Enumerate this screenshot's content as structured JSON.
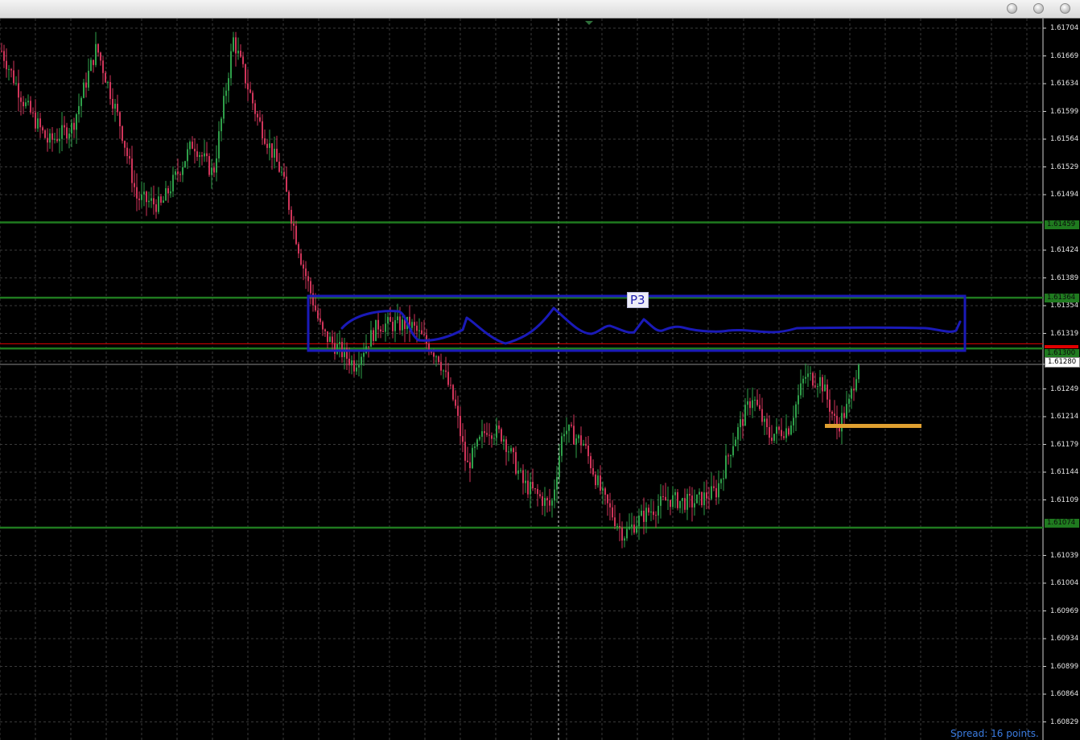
{
  "window": {
    "buttons": [
      "minimize",
      "zoom",
      "close"
    ]
  },
  "chart": {
    "instrument_type": "candlestick",
    "colors": {
      "background": "#000000",
      "grid": "#3a3a3a",
      "bull": "#2fa04a",
      "bear": "#d0355a",
      "level_line": "#1f7a1f",
      "rectangle": "#1a1ab8",
      "ask_line": "#e00000",
      "marker": "#e0a030"
    },
    "y_axis_labels": [
      "1.61704",
      "1.61669",
      "1.61634",
      "1.61599",
      "1.61564",
      "1.61529",
      "1.61494",
      "1.61424",
      "1.61389",
      "1.61354",
      "1.61319",
      "1.61280",
      "1.61249",
      "1.61214",
      "1.61179",
      "1.61144",
      "1.61109",
      "1.61039",
      "1.61004",
      "1.60969",
      "1.60934",
      "1.60899",
      "1.60864",
      "1.60829"
    ],
    "level_tags": [
      "1.61459",
      "1.61364",
      "1.61300",
      "1.61074"
    ],
    "bid_price": "1.61280",
    "rectangle_label": "P3",
    "spread_text": "Spread: 16 points."
  }
}
